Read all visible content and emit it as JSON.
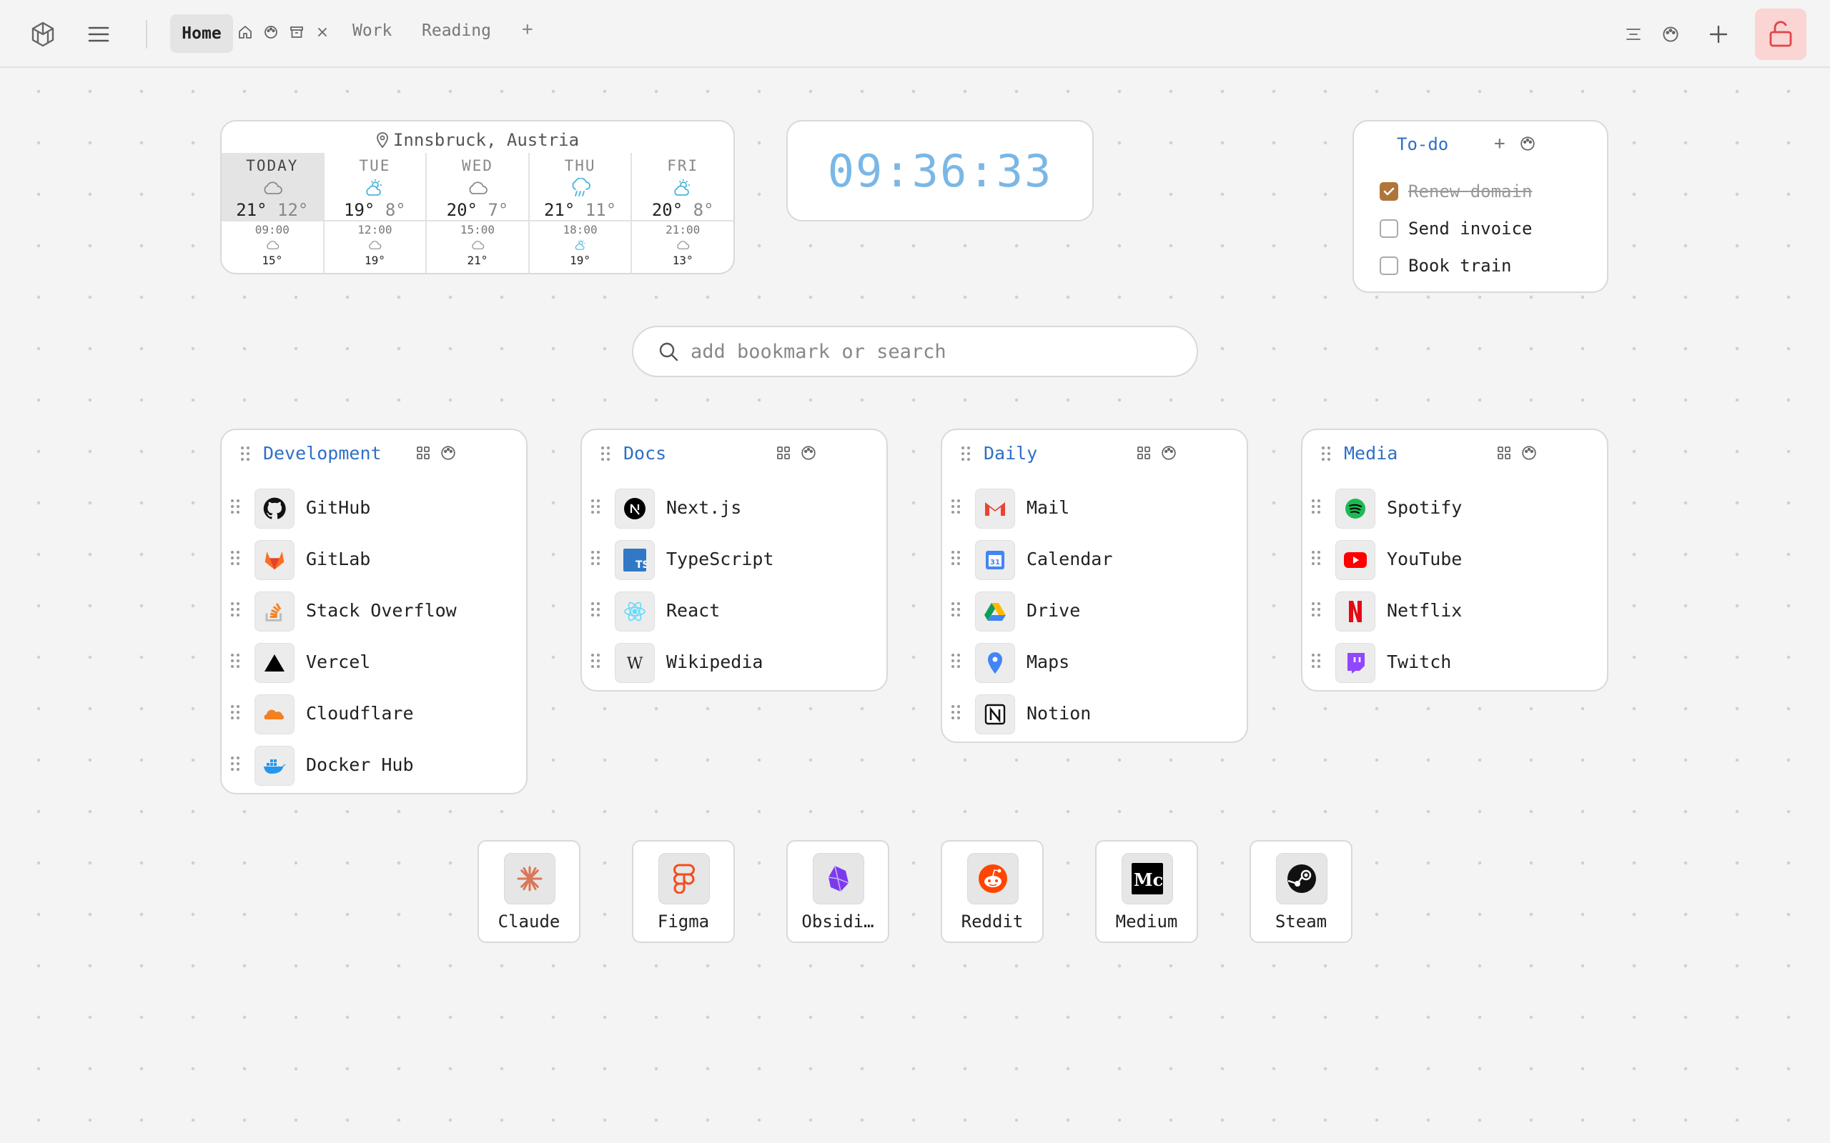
{
  "tabs": {
    "active": "Home",
    "others": [
      "Work",
      "Reading"
    ],
    "add": "+"
  },
  "weather": {
    "location": "Innsbruck, Austria",
    "days": [
      {
        "name": "TODAY",
        "hi": "21°",
        "lo": "12°",
        "icon": "cloud-icon",
        "hour": "09:00",
        "hour_icon": "cloud-icon",
        "hour_temp": "15°"
      },
      {
        "name": "TUE",
        "hi": "19°",
        "lo": "8°",
        "icon": "partly-sunny-icon",
        "hour": "12:00",
        "hour_icon": "cloud-icon",
        "hour_temp": "19°"
      },
      {
        "name": "WED",
        "hi": "20°",
        "lo": "7°",
        "icon": "cloud-icon",
        "hour": "15:00",
        "hour_icon": "cloud-icon",
        "hour_temp": "21°"
      },
      {
        "name": "THU",
        "hi": "21°",
        "lo": "11°",
        "icon": "rain-icon",
        "hour": "18:00",
        "hour_icon": "partly-sunny-icon",
        "hour_temp": "19°"
      },
      {
        "name": "FRI",
        "hi": "20°",
        "lo": "8°",
        "icon": "partly-sunny-icon",
        "hour": "21:00",
        "hour_icon": "cloud-icon",
        "hour_temp": "13°"
      }
    ]
  },
  "clock": {
    "time": "09:36:33",
    "color": "#7ab7e6"
  },
  "todo": {
    "title": "To-do",
    "add": "+",
    "items": [
      {
        "text": "Renew domain",
        "done": true
      },
      {
        "text": "Send invoice",
        "done": false
      },
      {
        "text": "Book train",
        "done": false
      }
    ]
  },
  "search": {
    "placeholder": "add bookmark or search"
  },
  "groups": [
    {
      "title": "Development",
      "items": [
        {
          "label": "GitHub",
          "icon": "github-icon"
        },
        {
          "label": "GitLab",
          "icon": "gitlab-icon"
        },
        {
          "label": "Stack Overflow",
          "icon": "stackoverflow-icon"
        },
        {
          "label": "Vercel",
          "icon": "vercel-icon"
        },
        {
          "label": "Cloudflare",
          "icon": "cloudflare-icon"
        },
        {
          "label": "Docker Hub",
          "icon": "docker-icon"
        }
      ]
    },
    {
      "title": "Docs",
      "items": [
        {
          "label": "Next.js",
          "icon": "nextjs-icon"
        },
        {
          "label": "TypeScript",
          "icon": "typescript-icon"
        },
        {
          "label": "React",
          "icon": "react-icon"
        },
        {
          "label": "Wikipedia",
          "icon": "wikipedia-icon"
        }
      ]
    },
    {
      "title": "Daily",
      "items": [
        {
          "label": "Mail",
          "icon": "gmail-icon"
        },
        {
          "label": "Calendar",
          "icon": "calendar-icon"
        },
        {
          "label": "Drive",
          "icon": "drive-icon"
        },
        {
          "label": "Maps",
          "icon": "maps-icon"
        },
        {
          "label": "Notion",
          "icon": "notion-icon"
        }
      ]
    },
    {
      "title": "Media",
      "items": [
        {
          "label": "Spotify",
          "icon": "spotify-icon"
        },
        {
          "label": "YouTube",
          "icon": "youtube-icon"
        },
        {
          "label": "Netflix",
          "icon": "netflix-icon"
        },
        {
          "label": "Twitch",
          "icon": "twitch-icon"
        }
      ]
    }
  ],
  "dock": [
    {
      "label": "Claude",
      "icon": "claude-icon"
    },
    {
      "label": "Figma",
      "icon": "figma-icon"
    },
    {
      "label": "Obsidi…",
      "icon": "obsidian-icon"
    },
    {
      "label": "Reddit",
      "icon": "reddit-icon"
    },
    {
      "label": "Medium",
      "icon": "medium-icon"
    },
    {
      "label": "Steam",
      "icon": "steam-icon"
    }
  ],
  "colors": {
    "accent": "#2f6fc6",
    "lock_bg": "#fbd4d4",
    "lock_fg": "#e0454a",
    "todo_check": "#b0753a"
  }
}
